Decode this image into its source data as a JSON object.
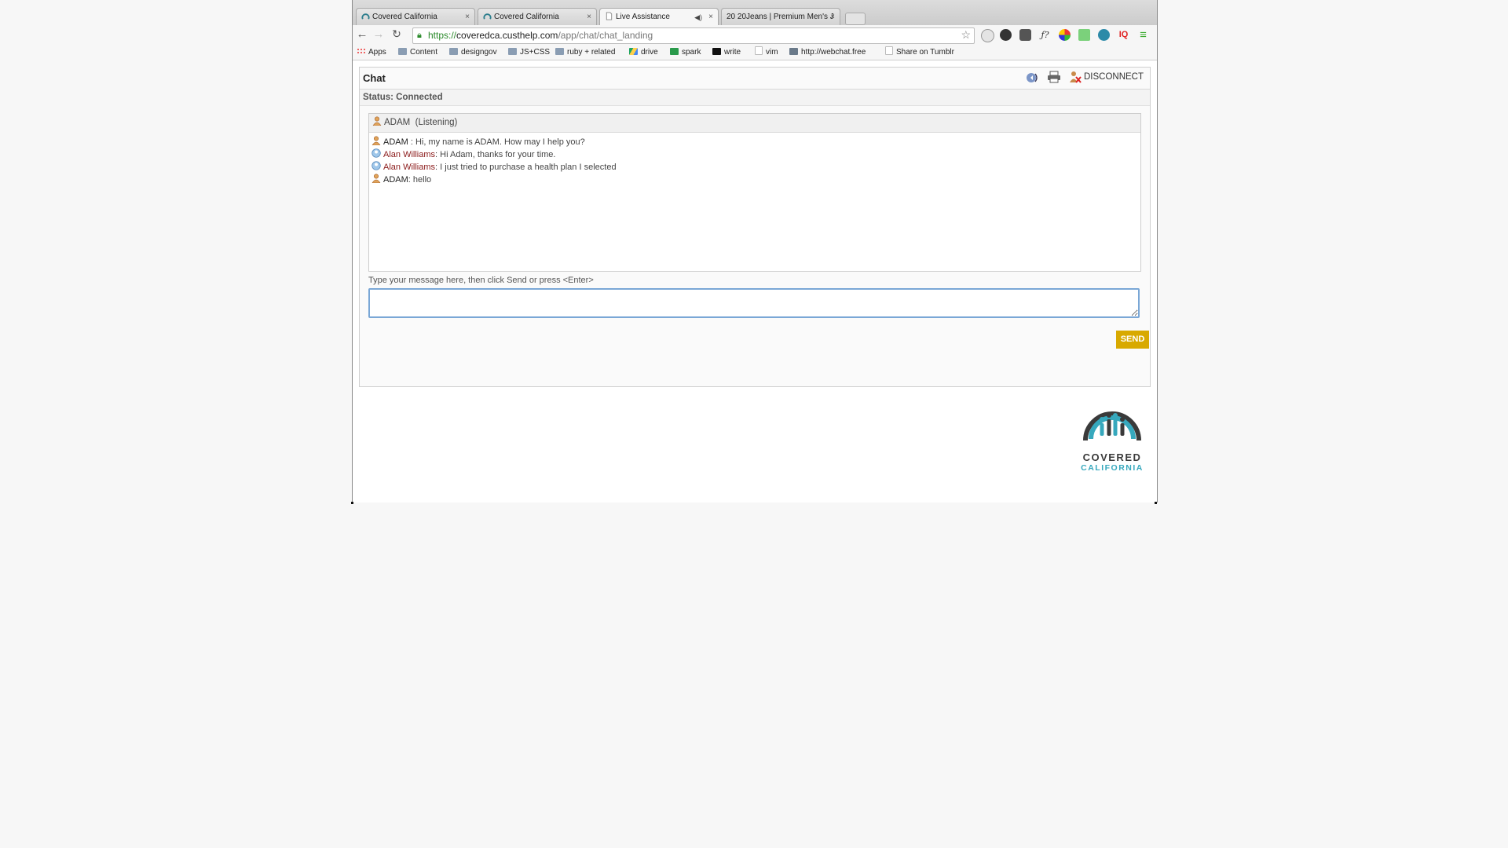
{
  "browser": {
    "tabs": [
      {
        "title": "Covered California",
        "favicon": "covered-ca-favicon",
        "active": false
      },
      {
        "title": "Covered California",
        "favicon": "covered-ca-favicon",
        "active": false
      },
      {
        "title": "Live Assistance",
        "favicon": "page-favicon",
        "active": true,
        "playing_audio": true
      },
      {
        "title": "20 20Jeans | Premium Men's J",
        "favicon": "none",
        "active": false
      }
    ],
    "close_glyph": "×",
    "url_scheme": "https://",
    "url_host": "coveredca.custhelp.com",
    "url_path": "/app/chat/chat_landing",
    "bookmarks": [
      {
        "label": "Apps",
        "icon": "apps-grid-icon"
      },
      {
        "label": "Content",
        "icon": "folder-icon"
      },
      {
        "label": "designgov",
        "icon": "folder-icon"
      },
      {
        "label": "JS+CSS",
        "icon": "folder-icon"
      },
      {
        "label": "ruby + related",
        "icon": "folder-icon"
      },
      {
        "label": "drive",
        "icon": "drive-icon"
      },
      {
        "label": "spark",
        "icon": "spark-icon"
      },
      {
        "label": "write",
        "icon": "medium-icon"
      },
      {
        "label": "vim",
        "icon": "page-icon"
      },
      {
        "label": "http://webchat.free",
        "icon": "webchat-icon"
      },
      {
        "label": "Share on Tumblr",
        "icon": "page-icon"
      }
    ]
  },
  "chat": {
    "title": "Chat",
    "disconnect_label": "DISCONNECT",
    "status": "Status: Connected",
    "agent_name": "ADAM",
    "agent_state": "(Listening)",
    "messages": [
      {
        "sender": "ADAM",
        "sep": " : ",
        "text": "Hi, my name is ADAM. How may I help you?",
        "role": "agent"
      },
      {
        "sender": "Alan Williams",
        "sep": ": ",
        "text": "Hi Adam, thanks for your time.",
        "role": "user"
      },
      {
        "sender": "Alan Williams",
        "sep": ": ",
        "text": "I just tried to purchase a health plan I selected",
        "role": "user"
      },
      {
        "sender": "ADAM",
        "sep": ": ",
        "text": "hello",
        "role": "agent"
      }
    ],
    "input_prompt": "Type your message here, then click Send or press <Enter>",
    "input_value": "",
    "send_label": "SEND"
  },
  "logo": {
    "line1": "COVERED",
    "line2": "CALIFORNIA"
  },
  "colors": {
    "send_button": "#d8a900",
    "user_name": "#8b1a1a",
    "logo_teal": "#36a8bd",
    "input_focus": "#7aa7d6"
  }
}
